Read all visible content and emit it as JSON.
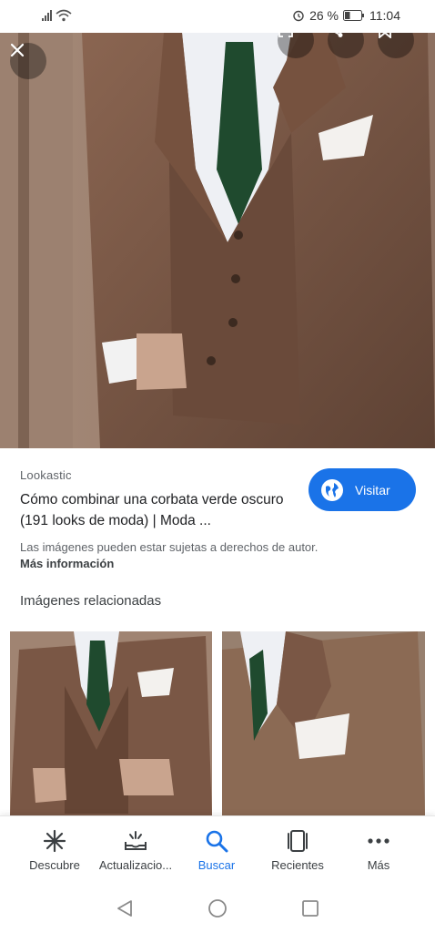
{
  "status_bar": {
    "battery": "26 %",
    "time": "11:04"
  },
  "hero": {
    "close_icon": "close-icon",
    "actions": [
      "lens-icon",
      "share-icon",
      "bookmark-icon"
    ]
  },
  "result": {
    "source": "Lookastic",
    "title": "Cómo combinar una corbata verde oscuro (191 looks de moda) | Moda ...",
    "visit_label": "Visitar",
    "copyright": "Las imágenes pueden estar sujetas a derechos de autor.",
    "more_info": "Más información"
  },
  "related": {
    "heading": "Imágenes relacionadas"
  },
  "bottom_nav": {
    "items": [
      {
        "label": "Descubre",
        "icon": "asterisk-icon"
      },
      {
        "label": "Actualizacio...",
        "icon": "updates-icon"
      },
      {
        "label": "Buscar",
        "icon": "search-icon"
      },
      {
        "label": "Recientes",
        "icon": "recents-icon"
      },
      {
        "label": "Más",
        "icon": "more-icon"
      }
    ]
  },
  "colors": {
    "accent": "#1a73e8",
    "suit": "#7a5a47",
    "tie": "#1f4a2e"
  }
}
